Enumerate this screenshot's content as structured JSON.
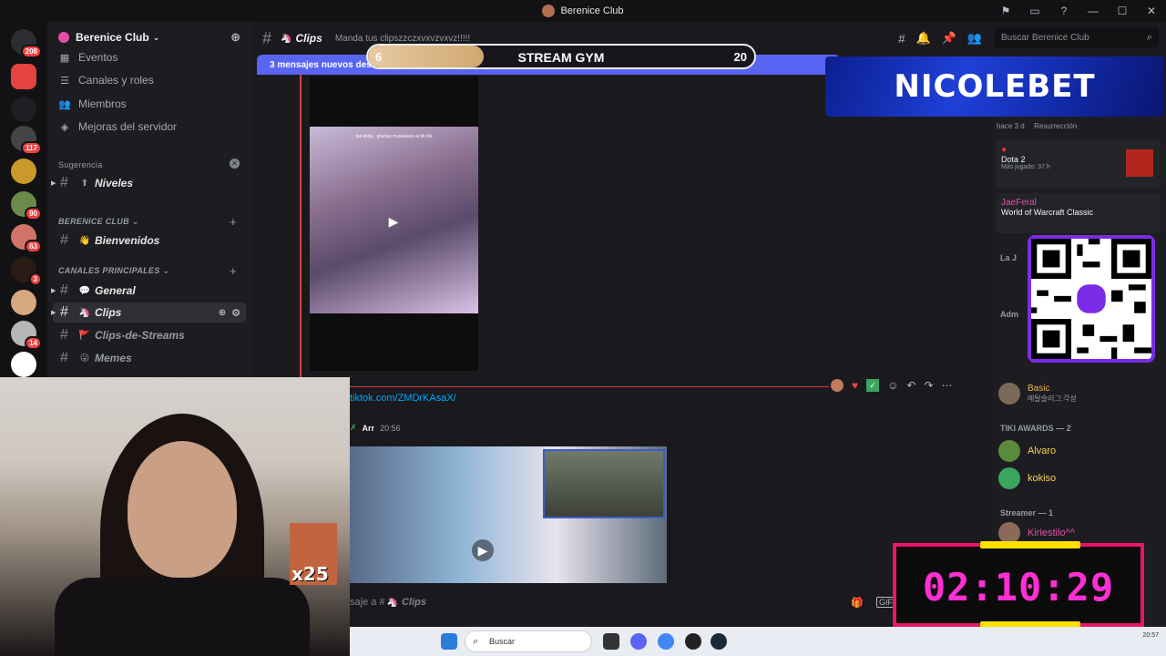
{
  "window": {
    "title": "Berenice Club"
  },
  "server": {
    "name": "Berenice Club",
    "rail_badges": [
      "208",
      "117",
      "90",
      "63",
      "3",
      "14"
    ]
  },
  "sidebar": {
    "nav": [
      {
        "icon": "calendar-icon",
        "label": "Eventos"
      },
      {
        "icon": "list-icon",
        "label": "Canales y roles"
      },
      {
        "icon": "members-icon",
        "label": "Miembros"
      },
      {
        "icon": "boost-icon",
        "label": "Mejoras del servidor"
      }
    ],
    "suggestion_label": "Sugerencia",
    "suggestion_channel": "Niveles",
    "category_1": "BERENICE CLUB",
    "cat1_channel": "Bienvenidos",
    "category_2": "CANALES PRINCIPALES",
    "channels": [
      {
        "name": "General",
        "emoji": "💬"
      },
      {
        "name": "Clips",
        "emoji": "🦄"
      },
      {
        "name": "Clips-de-Streams",
        "emoji": "🚩"
      },
      {
        "name": "Memes",
        "emoji": "😛"
      }
    ]
  },
  "chat": {
    "channel_name": "Clips",
    "topic": "Manda tus clipszzczxvxvzvxvz!!!!!",
    "new_messages": "3 mensajes nuevos desde",
    "link": "tiktok.com/ZMDrKAsaX/",
    "author": "Arr",
    "time": "20:56",
    "input_prefix": "saje a #",
    "input_channel": "Clips",
    "video_caption": "tan linda , gracias muselasss al tik tok"
  },
  "search": {
    "placeholder": "Buscar Berenice Club"
  },
  "overlay": {
    "gym_left": "6",
    "gym_title": "STREAM GYM",
    "gym_right": "20",
    "gym_progress": 0.3,
    "sponsor": "NICOLEBET",
    "emote_count": "x25",
    "timer": "02:10:29"
  },
  "members": {
    "activity_time": "hace 3 d",
    "activity_tag": "Resurrección",
    "card2_game": "Dota 2",
    "card2_sub": "Más jugado: 37 h",
    "card3_name": "JaeFeral",
    "card3_game": "World of Warcraft Classic",
    "basic_name": "Basic",
    "basic_status": "메탈슬러그:각성",
    "group_tiki": "TIKI AWARDS — 2",
    "tiki_members": [
      "Alvaro",
      "kokiso"
    ],
    "group_streamer": "Streamer — 1",
    "streamer_member": "Kiriestilo^^"
  },
  "taskbar": {
    "search": "Buscar",
    "time": "20:57"
  },
  "colors": {
    "accent": "#5865f2",
    "timer": "#ff2fd4",
    "timer_border": "#e91568",
    "danger": "#f23f43"
  }
}
